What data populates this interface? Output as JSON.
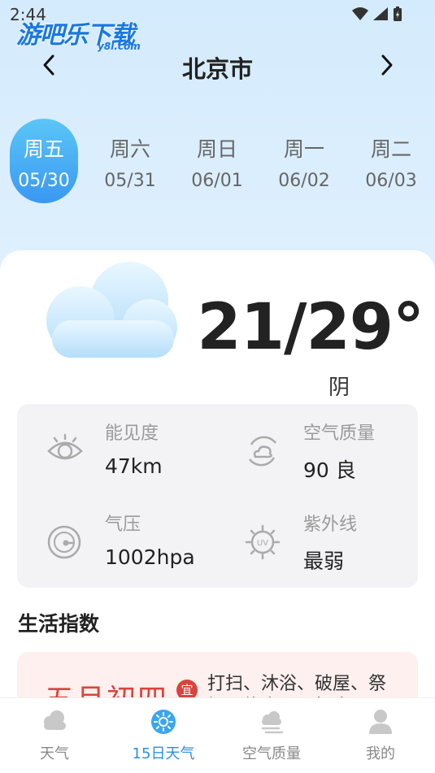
{
  "status_bar": {
    "time": "2:44"
  },
  "watermark": {
    "main": "游吧乐下载",
    "sub": "y8l.com"
  },
  "header": {
    "prev_icon": "chevron-left-icon",
    "title": "北京市",
    "next_icon": "chevron-right-icon"
  },
  "days": [
    {
      "name": "周五",
      "date": "05/30",
      "active": true
    },
    {
      "name": "周六",
      "date": "05/31",
      "active": false
    },
    {
      "name": "周日",
      "date": "06/01",
      "active": false
    },
    {
      "name": "周一",
      "date": "06/02",
      "active": false
    },
    {
      "name": "周二",
      "date": "06/03",
      "active": false
    }
  ],
  "weather": {
    "icon": "cloud-icon",
    "temperature": "21/29°",
    "condition": "阴"
  },
  "metrics": [
    {
      "label": "能见度",
      "value": "47km",
      "icon": "eye-icon"
    },
    {
      "label": "空气质量",
      "value": "90 良",
      "icon": "air-quality-icon"
    },
    {
      "label": "气压",
      "value": "1002hpa",
      "icon": "pressure-gauge-icon"
    },
    {
      "label": "紫外线",
      "value": "最弱",
      "icon": "uv-icon"
    }
  ],
  "life_index": {
    "title": "生活指数",
    "lunar_date": "五月初四",
    "yi_badge": "宜",
    "yi_text": "打扫、沐浴、破屋、祭祀、修房屋、扫舍"
  },
  "bottom_nav": [
    {
      "label": "天气",
      "icon": "weather-cloud-icon",
      "active": false
    },
    {
      "label": "15日天气",
      "icon": "forecast-15day-icon",
      "active": true
    },
    {
      "label": "空气质量",
      "icon": "air-quality-nav-icon",
      "active": false
    },
    {
      "label": "我的",
      "icon": "user-icon",
      "active": false
    }
  ],
  "colors": {
    "accent": "#2b8fe8",
    "lunar_red": "#d9443c",
    "sky": "#d4ebfd"
  }
}
